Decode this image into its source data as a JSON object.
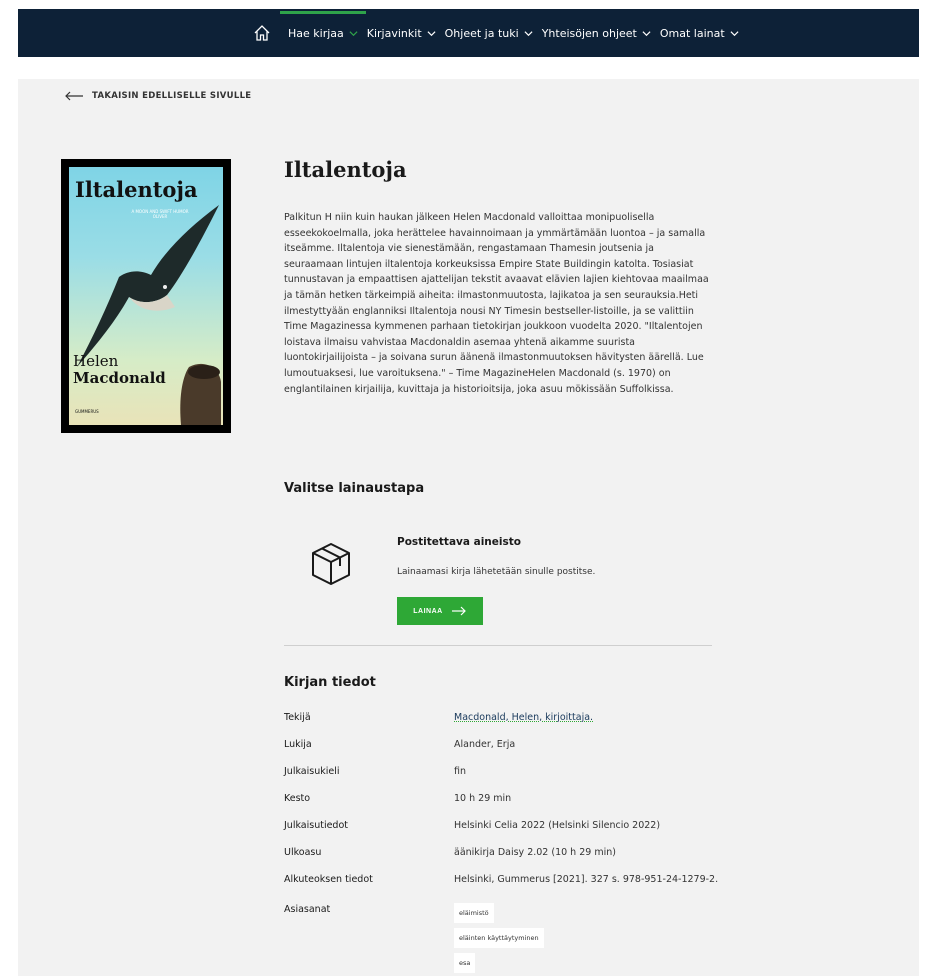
{
  "nav": {
    "items": [
      {
        "label": "Hae kirjaa",
        "active": true
      },
      {
        "label": "Kirjavinkit",
        "active": false
      },
      {
        "label": "Ohjeet ja tuki",
        "active": false
      },
      {
        "label": "Yhteisöjen ohjeet",
        "active": false
      },
      {
        "label": "Omat lainat",
        "active": false
      }
    ]
  },
  "back_label": "TAKAISIN EDELLISELLE SIVULLE",
  "cover": {
    "title": "Iltalentoja",
    "author_line1": "Helen",
    "author_line2": "Macdonald",
    "subtitle": "A MOON AND SWIFT HUMOR OLIVER",
    "publisher": "GUMMERUS"
  },
  "book": {
    "title": "Iltalentoja",
    "description": "Palkitun H niin kuin haukan jälkeen Helen Macdonald valloittaa monipuolisella esseekokoelmalla, joka herättelee havainnoimaan ja ymmärtämään luontoa – ja samalla itseämme. Iltalentoja vie sienestämään, rengastamaan Thamesin joutsenia ja seuraamaan lintujen iltalentoja korkeuksissa Empire State Buildingin katolta. Tosiasiat tunnustavan ja empaattisen ajattelijan tekstit avaavat elävien lajien kiehtovaa maailmaa ja tämän hetken tärkeimpiä aiheita: ilmastonmuutosta, lajikatoa ja sen seurauksia.Heti ilmestyttyään englanniksi Iltalentoja nousi NY Timesin bestseller-listoille, ja se valittiin Time Magazinessa kymmenen parhaan tietokirjan joukkoon vuodelta 2020. \"Iltalentojen loistava ilmaisu vahvistaa Macdonaldin asemaa yhtenä aikamme suurista luontokirjailijoista – ja soivana surun äänenä ilmastonmuutoksen hävitysten äärellä. Lue lumoutuaksesi, lue varoituksena.\" – Time MagazineHelen Macdonald (s. 1970) on englantilainen kirjailija, kuvittaja ja historioitsija, joka asuu mökissään Suffolkissa."
  },
  "loan": {
    "heading": "Valitse lainaustapa",
    "option_title": "Postitettava aineisto",
    "option_text": "Lainaamasi kirja lähetetään sinulle postitse.",
    "button_label": "LAINAA"
  },
  "info": {
    "heading": "Kirjan tiedot",
    "rows": [
      {
        "key": "Tekijä",
        "value": "Macdonald, Helen, kirjoittaja."
      },
      {
        "key": "Lukija",
        "value": "Alander, Erja"
      },
      {
        "key": "Julkaisukieli",
        "value": "fin"
      },
      {
        "key": "Kesto",
        "value": "10 h 29 min"
      },
      {
        "key": "Julkaisutiedot",
        "value": "Helsinki Celia 2022 (Helsinki Silencio 2022)"
      },
      {
        "key": "Ulkoasu",
        "value": "äänikirja Daisy 2.02 (10 h 29 min)"
      },
      {
        "key": "Alkuteoksen tiedot",
        "value": "Helsinki, Gummerus [2021]. 327 s. 978-951-24-1279-2."
      }
    ],
    "subjects_key": "Asiasanat",
    "subjects": [
      "eläimistö",
      "eläinten käyttäytyminen",
      "esa"
    ]
  },
  "colors": {
    "nav_bg": "#0d2137",
    "accent": "#2ea836",
    "page_bg": "#f2f2f2"
  }
}
